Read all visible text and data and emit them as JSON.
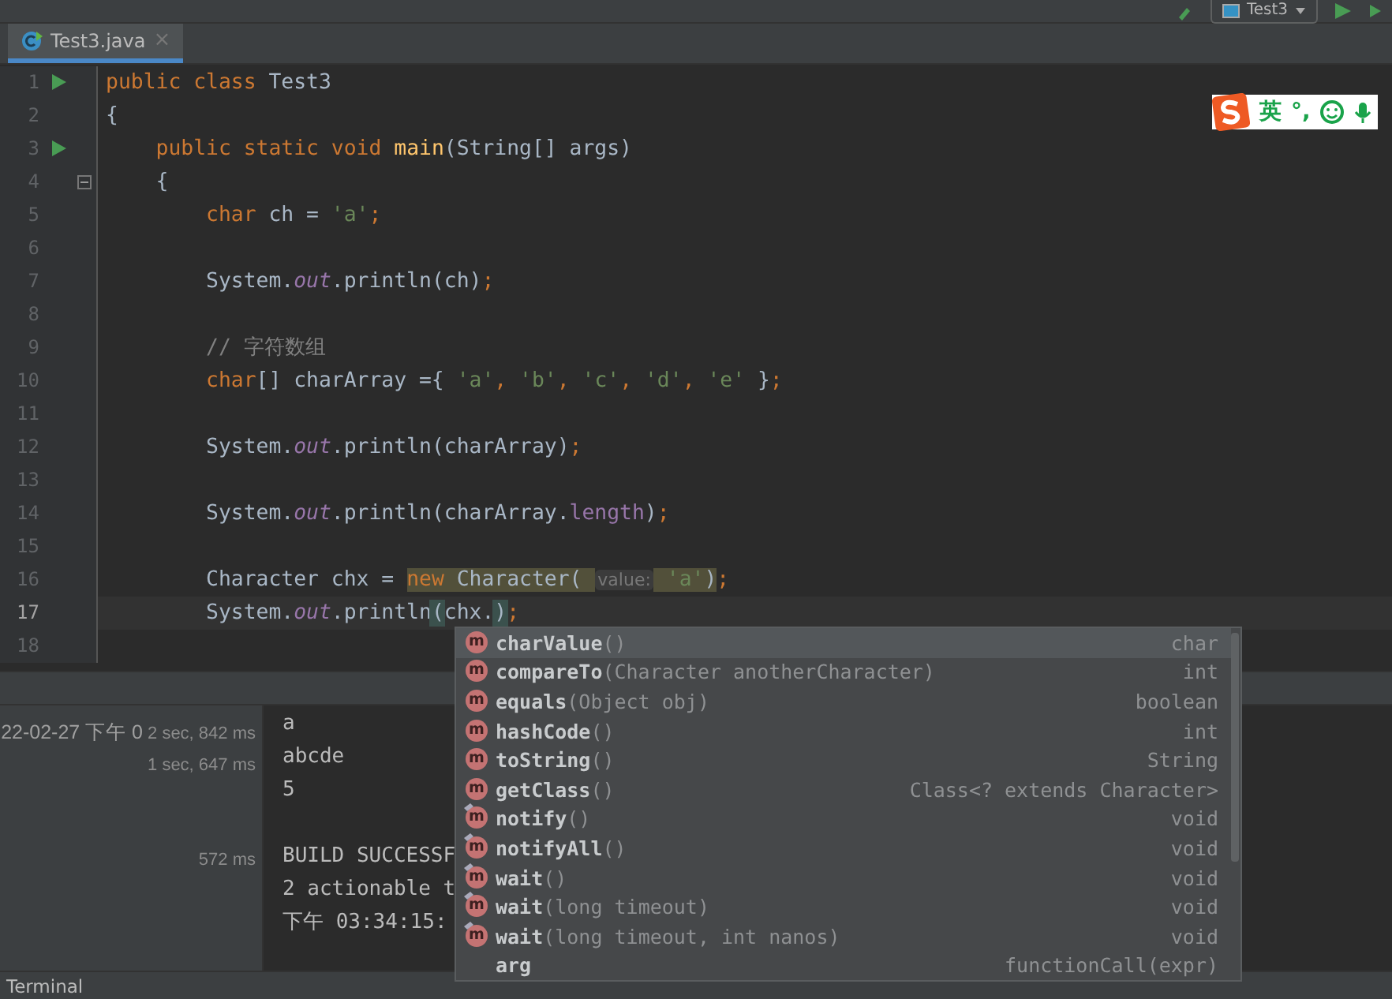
{
  "toolbar": {
    "run_config": "Test3"
  },
  "tabs": [
    {
      "label": "Test3.java",
      "selected": true,
      "close": "×"
    }
  ],
  "ime_bar": {
    "mode": "英",
    "punctuation": "°,"
  },
  "editor": {
    "lines": [
      {
        "number": "1",
        "run": true,
        "fold": false,
        "current": false,
        "tokens": [
          {
            "keyword": "public class "
          },
          {
            "plain": "Test3"
          }
        ]
      },
      {
        "number": "2",
        "run": false,
        "fold": false,
        "current": false,
        "tokens": [
          {
            "plain": "{"
          }
        ]
      },
      {
        "number": "3",
        "run": true,
        "fold": false,
        "current": false,
        "tokens": [
          {
            "keyword": "    public static void "
          },
          {
            "method": "main"
          },
          {
            "plain": "(String[] args)"
          }
        ]
      },
      {
        "number": "4",
        "run": false,
        "fold": true,
        "current": false,
        "tokens": [
          {
            "plain": "    {"
          }
        ]
      },
      {
        "number": "5",
        "run": false,
        "fold": false,
        "current": false,
        "tokens": [
          {
            "keyword": "        char "
          },
          {
            "plain": "ch = "
          },
          {
            "string": "'a'"
          },
          {
            "keyword": ";"
          }
        ]
      },
      {
        "number": "6",
        "run": false,
        "fold": false,
        "current": false
      },
      {
        "number": "7",
        "run": false,
        "fold": false,
        "current": false,
        "tokens": [
          {
            "plain": "        System."
          },
          {
            "field": "out"
          },
          {
            "plain": ".println(ch)"
          },
          {
            "keyword": ";"
          }
        ]
      },
      {
        "number": "8",
        "run": false,
        "fold": false,
        "current": false
      },
      {
        "number": "9",
        "run": false,
        "fold": false,
        "current": false,
        "tokens": [
          {
            "comment": "        // 字符数组"
          }
        ]
      },
      {
        "number": "10",
        "run": false,
        "fold": false,
        "current": false,
        "tokens": [
          {
            "keyword": "        char"
          },
          {
            "plain": "[] charArray ={ "
          },
          {
            "string": "'a'"
          },
          {
            "keyword": ", "
          },
          {
            "string": "'b'"
          },
          {
            "keyword": ", "
          },
          {
            "string": "'c'"
          },
          {
            "keyword": ", "
          },
          {
            "string": "'d'"
          },
          {
            "keyword": ", "
          },
          {
            "string": "'e'"
          },
          {
            "plain": " }"
          },
          {
            "keyword": ";"
          }
        ]
      },
      {
        "number": "11",
        "run": false,
        "fold": false,
        "current": false
      },
      {
        "number": "12",
        "run": false,
        "fold": false,
        "current": false,
        "tokens": [
          {
            "plain": "        System."
          },
          {
            "field": "out"
          },
          {
            "plain": ".println(charArray)"
          },
          {
            "keyword": ";"
          }
        ]
      },
      {
        "number": "13",
        "run": false,
        "fold": false,
        "current": false
      },
      {
        "number": "14",
        "run": false,
        "fold": false,
        "current": false,
        "tokens": [
          {
            "plain": "        System."
          },
          {
            "field": "out"
          },
          {
            "plain": ".println(charArray."
          },
          {
            "member": "length"
          },
          {
            "plain": ")"
          },
          {
            "keyword": ";"
          }
        ]
      },
      {
        "number": "15",
        "run": false,
        "fold": false,
        "current": false
      },
      {
        "number": "16",
        "run": false,
        "fold": false,
        "current": false,
        "tokens": [
          {
            "plain": "        Character chx = "
          },
          {
            "keyword": "new ",
            "highlighted": true
          },
          {
            "plain": "Character( ",
            "highlighted": true
          },
          {
            "hint": "value:",
            "highlighted": true
          },
          {
            "string": " 'a'",
            "highlighted": true
          },
          {
            "plain": ")",
            "highlighted": true
          },
          {
            "keyword": ";"
          }
        ]
      },
      {
        "number": "17",
        "run": false,
        "fold": false,
        "current": true,
        "tokens": [
          {
            "plain": "        System."
          },
          {
            "field": "out"
          },
          {
            "plain": ".println"
          },
          {
            "plain": "(",
            "matched": true
          },
          {
            "plain": "chx."
          },
          {
            "plain": ")",
            "matched": true
          },
          {
            "keyword": ";"
          }
        ]
      },
      {
        "number": "18",
        "run": false,
        "fold": false,
        "current": false
      }
    ]
  },
  "build_tree": [
    {
      "label": "22-02-27 下午 0",
      "time": "2 sec, 842 ms"
    },
    {
      "time": "1 sec, 647 ms"
    },
    {
      "time": "572 ms"
    }
  ],
  "console": {
    "blocks": [
      [
        "a",
        "abcde",
        "5"
      ],
      [
        "BUILD SUCCESSF",
        "2 actionable t",
        "下午 03:34:15:"
      ]
    ]
  },
  "completion": [
    {
      "kind": "method",
      "icon": "m",
      "name": "charValue",
      "params": "()",
      "type": "char",
      "selected": true
    },
    {
      "kind": "method",
      "icon": "m",
      "name": "compareTo",
      "params": "(Character anotherCharacter)",
      "type": "int",
      "selected": false
    },
    {
      "kind": "method",
      "icon": "m",
      "name": "equals",
      "params": "(Object obj)",
      "type": "boolean",
      "selected": false
    },
    {
      "kind": "method",
      "icon": "m",
      "name": "hashCode",
      "params": "()",
      "type": "int",
      "selected": false
    },
    {
      "kind": "method",
      "icon": "m",
      "name": "toString",
      "params": "()",
      "type": "String",
      "selected": false
    },
    {
      "kind": "method",
      "icon": "m",
      "name": "getClass",
      "params": "()",
      "type": "Class<? extends Character>",
      "selected": false
    },
    {
      "kind": "inherited",
      "icon": "m",
      "name": "notify",
      "params": "()",
      "type": "void",
      "selected": false
    },
    {
      "kind": "inherited",
      "icon": "m",
      "name": "notifyAll",
      "params": "()",
      "type": "void",
      "selected": false
    },
    {
      "kind": "inherited",
      "icon": "m",
      "name": "wait",
      "params": "()",
      "type": "void",
      "selected": false
    },
    {
      "kind": "inherited",
      "icon": "m",
      "name": "wait",
      "params": "(long timeout)",
      "type": "void",
      "selected": false
    },
    {
      "kind": "inherited",
      "icon": "m",
      "name": "wait",
      "params": "(long timeout, int nanos)",
      "type": "void",
      "selected": false
    },
    {
      "kind": "template",
      "name": "arg",
      "type": "functionCall(expr)",
      "selected": false
    }
  ],
  "status_bar": {
    "tool": "Terminal"
  }
}
